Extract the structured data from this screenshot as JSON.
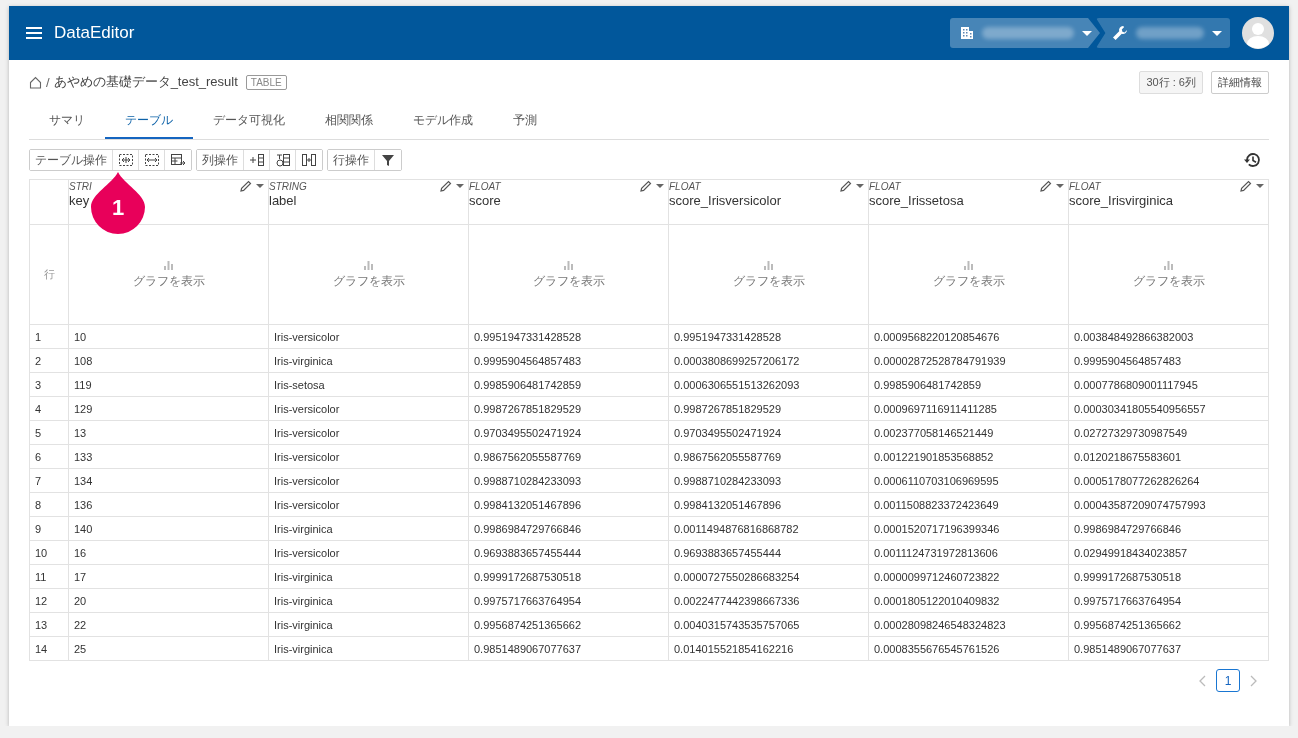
{
  "app": {
    "title": "DataEditor"
  },
  "breadcrumb": {
    "separator": "/",
    "dataset": "あやめの基礎データ_test_result",
    "badge": "TABLE"
  },
  "info": {
    "size": "30行 : 6列",
    "details_button": "詳細情報"
  },
  "tabs": [
    {
      "label": "サマリ",
      "selected": false
    },
    {
      "label": "テーブル",
      "selected": true
    },
    {
      "label": "データ可視化",
      "selected": false
    },
    {
      "label": "相関関係",
      "selected": false
    },
    {
      "label": "モデル作成",
      "selected": false
    },
    {
      "label": "予測",
      "selected": false
    }
  ],
  "toolbar": [
    {
      "label": "テーブル操作",
      "tools": [
        {
          "kind": "expand"
        },
        {
          "kind": "shrink"
        },
        {
          "kind": "export"
        }
      ]
    },
    {
      "label": "列操作",
      "tools": [
        {
          "kind": "add-column"
        },
        {
          "kind": "calc-column"
        },
        {
          "kind": "merge-column"
        }
      ]
    },
    {
      "label": "行操作",
      "tools": [
        {
          "kind": "filter"
        }
      ]
    }
  ],
  "callout": {
    "text": "1"
  },
  "table": {
    "row_header": "行",
    "columns": [
      {
        "type": "STRI",
        "name": "key",
        "graph_link": "グラフを表示"
      },
      {
        "type": "STRING",
        "name": "label",
        "graph_link": "グラフを表示"
      },
      {
        "type": "FLOAT",
        "name": "score",
        "graph_link": "グラフを表示"
      },
      {
        "type": "FLOAT",
        "name": "score_Irisversicolor",
        "graph_link": "グラフを表示"
      },
      {
        "type": "FLOAT",
        "name": "score_Irissetosa",
        "graph_link": "グラフを表示"
      },
      {
        "type": "FLOAT",
        "name": "score_Irisvirginica",
        "graph_link": "グラフを表示"
      }
    ],
    "rows": [
      {
        "number": "1",
        "cells": [
          "10",
          "Iris-versicolor",
          "0.9951947331428528",
          "0.9951947331428528",
          "0.0009568220120854676",
          "0.003848492866382003"
        ]
      },
      {
        "number": "2",
        "cells": [
          "108",
          "Iris-virginica",
          "0.9995904564857483",
          "0.0003808699257206172",
          "0.00002872528784791939",
          "0.9995904564857483"
        ]
      },
      {
        "number": "3",
        "cells": [
          "119",
          "Iris-setosa",
          "0.9985906481742859",
          "0.0006306551513262093",
          "0.9985906481742859",
          "0.0007786809001117945"
        ]
      },
      {
        "number": "4",
        "cells": [
          "129",
          "Iris-versicolor",
          "0.9987267851829529",
          "0.9987267851829529",
          "0.0009697116911411285",
          "0.00030341805540956557"
        ]
      },
      {
        "number": "5",
        "cells": [
          "13",
          "Iris-versicolor",
          "0.9703495502471924",
          "0.9703495502471924",
          "0.002377058146521449",
          "0.02727329730987549"
        ]
      },
      {
        "number": "6",
        "cells": [
          "133",
          "Iris-versicolor",
          "0.9867562055587769",
          "0.9867562055587769",
          "0.001221901853568852",
          "0.0120218675583601"
        ]
      },
      {
        "number": "7",
        "cells": [
          "134",
          "Iris-versicolor",
          "0.9988710284233093",
          "0.9988710284233093",
          "0.0006110703106969595",
          "0.0005178077262826264"
        ]
      },
      {
        "number": "8",
        "cells": [
          "136",
          "Iris-versicolor",
          "0.9984132051467896",
          "0.9984132051467896",
          "0.0011508823372423649",
          "0.00043587209074757993"
        ]
      },
      {
        "number": "9",
        "cells": [
          "140",
          "Iris-virginica",
          "0.9986984729766846",
          "0.0011494876816868782",
          "0.0001520717196399346",
          "0.9986984729766846"
        ]
      },
      {
        "number": "10",
        "cells": [
          "16",
          "Iris-versicolor",
          "0.9693883657455444",
          "0.9693883657455444",
          "0.0011124731972813606",
          "0.02949918434023857"
        ]
      },
      {
        "number": "11",
        "cells": [
          "17",
          "Iris-virginica",
          "0.9999172687530518",
          "0.0000727550286683254",
          "0.0000099712460723822",
          "0.9999172687530518"
        ]
      },
      {
        "number": "12",
        "cells": [
          "20",
          "Iris-virginica",
          "0.9975717663764954",
          "0.0022477442398667336",
          "0.0001805122010409832",
          "0.9975717663764954"
        ]
      },
      {
        "number": "13",
        "cells": [
          "22",
          "Iris-virginica",
          "0.9956874251365662",
          "0.0040315743535757065",
          "0.00028098246548324823",
          "0.9956874251365662"
        ]
      },
      {
        "number": "14",
        "cells": [
          "25",
          "Iris-virginica",
          "0.9851489067077637",
          "0.014015521854162216",
          "0.0008355676545761526",
          "0.9851489067077637"
        ]
      }
    ]
  },
  "pagination": {
    "pages": [
      {
        "label": "1",
        "selected": true
      }
    ]
  }
}
